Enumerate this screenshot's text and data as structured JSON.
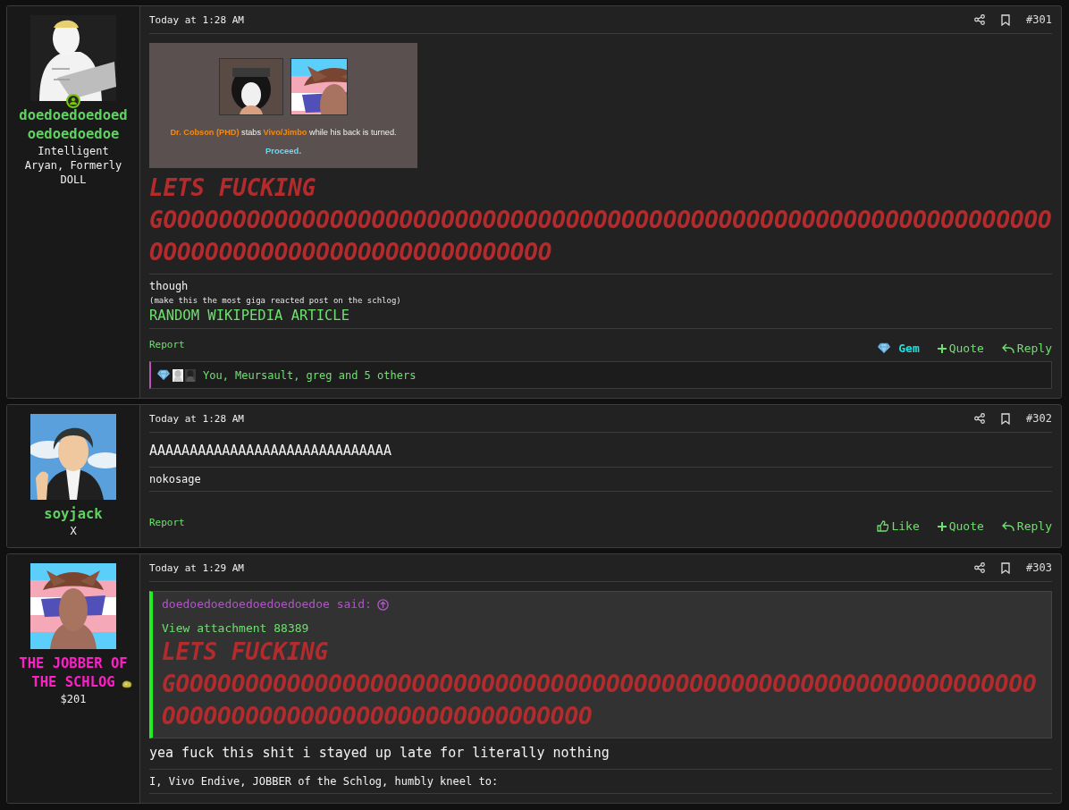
{
  "posts": [
    {
      "user": {
        "name": "doedoedoedoedoedoedoedoe",
        "color": "#5fd35f",
        "online": true,
        "nugget": false,
        "title": "Intelligent Aryan, Formerly DOLL"
      },
      "time": "Today at 1:28 AM",
      "number": "#301",
      "body": [
        {
          "kind": "attachment",
          "caption": [
            {
              "text": "Dr. Cobson (PHD)",
              "highlight": true
            },
            {
              "text": " stabs ",
              "highlight": false
            },
            {
              "text": "Vivo/Jimbo",
              "highlight": true
            },
            {
              "text": " while his back is turned.",
              "highlight": false
            }
          ],
          "proceed": "Proceed."
        },
        {
          "kind": "shout",
          "text": "LETS FUCKING GOOOOOOOOOOOOOOOOOOOOOOOOOOOOOOOOOOOOOOOOOOOOOOOOOOOOOOOOOOOOOOOOOOOOOOOOOOOOOOOOOOOOOOOOOOOOO"
        }
      ],
      "signature": [
        {
          "kind": "plain",
          "text": "though"
        },
        {
          "kind": "small",
          "text": "(make this the most giga reacted post on the schlog)"
        },
        {
          "kind": "link",
          "text": "RANDOM WIKIPEDIA ARTICLE"
        }
      ],
      "report": "Report",
      "actions": [
        {
          "kind": "gem",
          "label": "Gem"
        },
        {
          "kind": "quote",
          "label": "Quote"
        },
        {
          "kind": "reply",
          "label": "Reply"
        }
      ],
      "reactions": {
        "text": "You, Meursault, greg and 5 others"
      }
    },
    {
      "user": {
        "name": "soyjack",
        "color": "#5fd35f",
        "online": false,
        "nugget": false,
        "title": "X"
      },
      "time": "Today at 1:28 AM",
      "number": "#302",
      "body": [
        {
          "kind": "plain",
          "text": "AAAAAAAAAAAAAAAAAAAAAAAAAAAAAA"
        }
      ],
      "signature": [
        {
          "kind": "plain",
          "text": "nokosage"
        }
      ],
      "report": "Report",
      "actions": [
        {
          "kind": "like",
          "label": "Like"
        },
        {
          "kind": "quote",
          "label": "Quote"
        },
        {
          "kind": "reply",
          "label": "Reply"
        }
      ]
    },
    {
      "user": {
        "name": "THE JOBBER OF THE SCHLOG",
        "color": "#ff1fc8",
        "online": false,
        "nugget": true,
        "title": "$201"
      },
      "time": "Today at 1:29 AM",
      "number": "#303",
      "body": [
        {
          "kind": "quote",
          "author": "doedoedoedoedoedoedoedoe said:",
          "attachment": "View attachment 88389",
          "text": "LETS FUCKING GOOOOOOOOOOOOOOOOOOOOOOOOOOOOOOOOOOOOOOOOOOOOOOOOOOOOOOOOOOOOOOOOOOOOOOOOOOOOOOOOOOOOOOOOOOOOO"
        },
        {
          "kind": "plain",
          "text": "yea fuck this shit i stayed up late for literally nothing"
        }
      ],
      "signature": [
        {
          "kind": "plain",
          "text": "I, Vivo Endive, JOBBER of the Schlog, humbly kneel to:"
        }
      ]
    }
  ]
}
